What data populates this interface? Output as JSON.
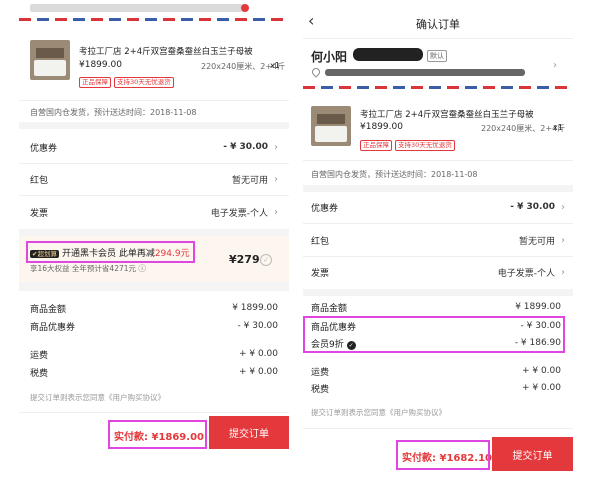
{
  "left": {
    "top_address_partial": "",
    "product": {
      "title": "考拉工厂店 2+4斤双宫蚕桑蚕丝白玉兰子母被",
      "price": "¥1899.00",
      "spec": "220x240厘米、2+4斤",
      "qty": "x1",
      "tags": [
        "正品保障",
        "支持30天无忧退货"
      ]
    },
    "delivery": "自营国内仓发货，预计送达时间：2018-11-08",
    "rows": [
      {
        "label": "优惠券",
        "value": "- ¥ 30.00"
      },
      {
        "label": "红包",
        "value": "暂无可用"
      },
      {
        "label": "发票",
        "value": "电子发票-个人"
      }
    ],
    "member": {
      "tag": "✔超划算",
      "text_a": "开通黑卡会员 此单再减",
      "text_b": "294.9元",
      "sub": "享16大权益 全年预计省4271元 ⓘ",
      "price": "¥279"
    },
    "summary": [
      {
        "label": "商品金额",
        "value": "¥ 1899.00",
        "red": false
      },
      {
        "label": "商品优惠券",
        "value": "- ¥ 30.00",
        "red": true
      },
      {
        "label": "运费",
        "value": "+ ¥ 0.00",
        "red": false
      },
      {
        "label": "税费",
        "value": "+ ¥ 0.00",
        "red": false
      }
    ],
    "agreement": "提交订单则表示您同意《用户购买协议》",
    "pay_label": "实付款: ¥1869.00",
    "submit": "提交订单"
  },
  "right": {
    "back_icon": "chevron-left-icon",
    "title": "确认订单",
    "name": "何小阳",
    "default_tag": "默认",
    "product": {
      "title": "考拉工厂店 2+4斤双宫蚕桑蚕丝白玉兰子母被",
      "price": "¥1899.00",
      "spec": "220x240厘米、2+4斤",
      "qty": "x1",
      "tags": [
        "正品保障",
        "支持30天无忧退货"
      ]
    },
    "delivery": "自营国内仓发货，预计送达时间：2018-11-08",
    "rows": [
      {
        "label": "优惠券",
        "value": "- ¥ 30.00"
      },
      {
        "label": "红包",
        "value": "暂无可用"
      },
      {
        "label": "发票",
        "value": "电子发票-个人"
      }
    ],
    "summary": [
      {
        "label": "商品金额",
        "value": "¥ 1899.00",
        "red": false
      },
      {
        "label": "商品优惠券",
        "value": "- ¥ 30.00",
        "red": true
      },
      {
        "label": "会员9折",
        "value": "- ¥ 186.90",
        "red": true
      },
      {
        "label": "运费",
        "value": "+ ¥ 0.00",
        "red": false
      },
      {
        "label": "税费",
        "value": "+ ¥ 0.00",
        "red": false
      }
    ],
    "agreement": "提交订单则表示您同意《用户购买协议》",
    "pay_label": "实付款: ¥1682.10",
    "submit": "提交订单"
  },
  "colors": {
    "accent": "#e4393c",
    "highlight": "#e046e0"
  }
}
